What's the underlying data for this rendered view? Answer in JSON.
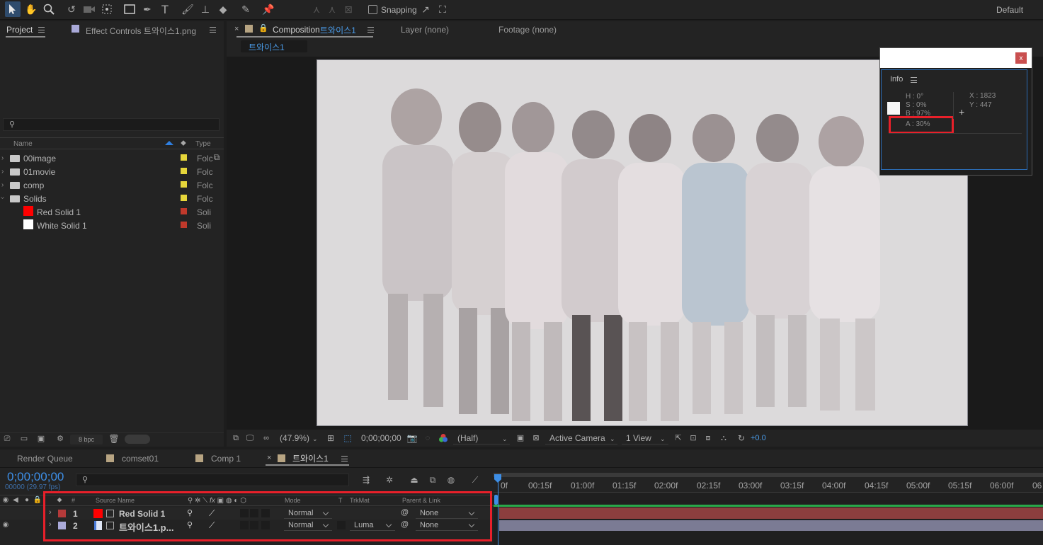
{
  "workspace": "Default",
  "toolbar": {
    "snapping_label": "Snapping"
  },
  "project_panel": {
    "tab_project": "Project",
    "tab_effect_controls": "Effect Controls 트와이스1.png",
    "columns": {
      "name": "Name",
      "type": "Type"
    },
    "items": [
      {
        "name": "00image",
        "type": "Folc",
        "label_color": "#e6d63a"
      },
      {
        "name": "01movie",
        "type": "Folc",
        "label_color": "#e6d63a"
      },
      {
        "name": "comp",
        "type": "Folc",
        "label_color": "#e6d63a"
      },
      {
        "name": "Solids",
        "type": "Folc",
        "label_color": "#e6d63a"
      },
      {
        "name": "Red Solid 1",
        "type": "Soli",
        "label_color": "#c0392b",
        "thumb": "#ff0000"
      },
      {
        "name": "White Solid 1",
        "type": "Soli",
        "label_color": "#c0392b",
        "thumb": "#ffffff"
      }
    ],
    "bpc": "8 bpc"
  },
  "viewer": {
    "tab_composition": "Composition",
    "comp_name": "트와이스1",
    "tab_layer": "Layer (none)",
    "tab_footage": "Footage (none)",
    "breadcrumb": "트와이스1",
    "zoom": "(47.9%)",
    "timecode": "0;00;00;00",
    "resolution": "(Half)",
    "camera": "Active Camera",
    "views": "1 View",
    "exposure": "+0.0"
  },
  "info_panel": {
    "title": "Info",
    "h": "H :  0°",
    "s": "S :  0%",
    "b": "B :  97%",
    "a": "A :  30%",
    "x": "X : 1823",
    "y": "Y :  447",
    "close": "x"
  },
  "timeline": {
    "tabs": [
      "Render Queue",
      "comset01",
      "Comp 1",
      "트와이스1"
    ],
    "timecode": "0;00;00;00",
    "fps": "00000 (29.97 fps)",
    "ruler": [
      "0f",
      "00:15f",
      "01:00f",
      "01:15f",
      "02:00f",
      "02:15f",
      "03:00f",
      "03:15f",
      "04:00f",
      "04:15f",
      "05:00f",
      "05:15f",
      "06:00f",
      "06"
    ],
    "headers": {
      "num": "#",
      "source": "Source Name",
      "mode": "Mode",
      "t": "T",
      "trkmat": "TrkMat",
      "parent": "Parent & Link"
    },
    "layers": [
      {
        "num": "1",
        "name": "Red Solid 1",
        "mode": "Normal",
        "trkmat": "",
        "parent": "None",
        "label_color": "#b43a3a",
        "thumb": "#ff0000"
      },
      {
        "num": "2",
        "name": "트와이스1.p...",
        "mode": "Normal",
        "trkmat": "Luma",
        "parent": "None",
        "label_color": "#a9a9d8",
        "thumb": "#4a7bd8"
      }
    ]
  }
}
